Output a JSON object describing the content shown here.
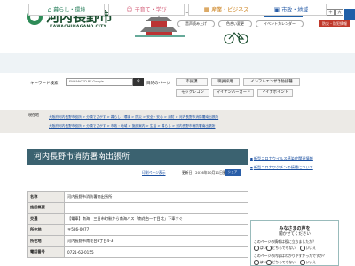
{
  "header": {
    "site_title": "河内長野市",
    "site_sub": "KAWACHINAGANO CITY",
    "links": [
      "ホーム",
      "ご意見",
      "サイトマップ"
    ],
    "foreign": "Foreign languages",
    "font_label": "文字サイズ",
    "font_sizes": [
      "小",
      "中",
      "大"
    ],
    "pills": [
      "音声読み上げ",
      "色合い変更",
      "イベントカレンダー"
    ],
    "emergency": "防災・防犯情報"
  },
  "nav": {
    "items": [
      {
        "icon": "home-icon",
        "label": "暮らし・環境"
      },
      {
        "icon": "child-icon",
        "label": "子育て・学び"
      },
      {
        "icon": "building-icon",
        "label": "産業・ビジネス"
      },
      {
        "icon": "city-icon",
        "label": "市政・地域"
      }
    ]
  },
  "search": {
    "keyword_label": "キーワード検索",
    "placeholder": "ENHANCED BY Google",
    "button_icon": "search-icon",
    "freq_label": "目的のページ",
    "quick_links": [
      "市民課",
      "職員採用",
      "インフルエンザ予防接種",
      "モックレコン",
      "マイナンバーカード",
      "マイナポイント"
    ]
  },
  "breadcrumb": {
    "label": "現在地",
    "trail1": "大阪府河内長野市役所 > 分類でさがす > 暮らし・環境 > 防災 > 安全・安心 > 消防 > 河内長野市消防署南出張所",
    "trail2": "大阪府河内長野市役所 > 分類でさがす > 市政・地域 > 施設案内 > 生活 > 暮らし > 河内長野市消防署南出張所"
  },
  "page": {
    "title": "河内長野市消防署南出張所",
    "print_label": "印刷ページ表示",
    "update_label": "更新日：2016年10月11日更新",
    "share_label": "シェア"
  },
  "table": {
    "rows": [
      {
        "key": "名称",
        "value": "河内長野市消防署南出張所"
      },
      {
        "key": "施設概要",
        "value": ""
      },
      {
        "key": "交通",
        "value": "【電車】南海　三日市町駅から南海バス「南花台一丁目北」下車すぐ"
      },
      {
        "key": "所在地",
        "value": "〒586-0077"
      },
      {
        "key": "所在地",
        "value": "河内長野市南花台8丁目4-3"
      },
      {
        "key": "電話番号",
        "value": "0721-62-0155"
      }
    ]
  },
  "sidebar": {
    "links": [
      "新型コロナウイルス感染症関連情報",
      "新型コロナワクチンの接種について"
    ],
    "survey_title": "みなさまの声を",
    "survey_sub": "聞かせてください",
    "q1": "このページの情報は役に立ちましたか？",
    "q1_options": [
      "はい",
      "どちらでもない",
      "いいえ"
    ],
    "q2": "このページの内容はわかりやすかったですか？",
    "q2_options": [
      "はい",
      "どちらでもない",
      "いいえ"
    ]
  },
  "colors": {
    "accent": "#1f5fa8",
    "title_bar": "#3b6270",
    "emergency": "#c0392b",
    "logo": "#2e8b57"
  }
}
